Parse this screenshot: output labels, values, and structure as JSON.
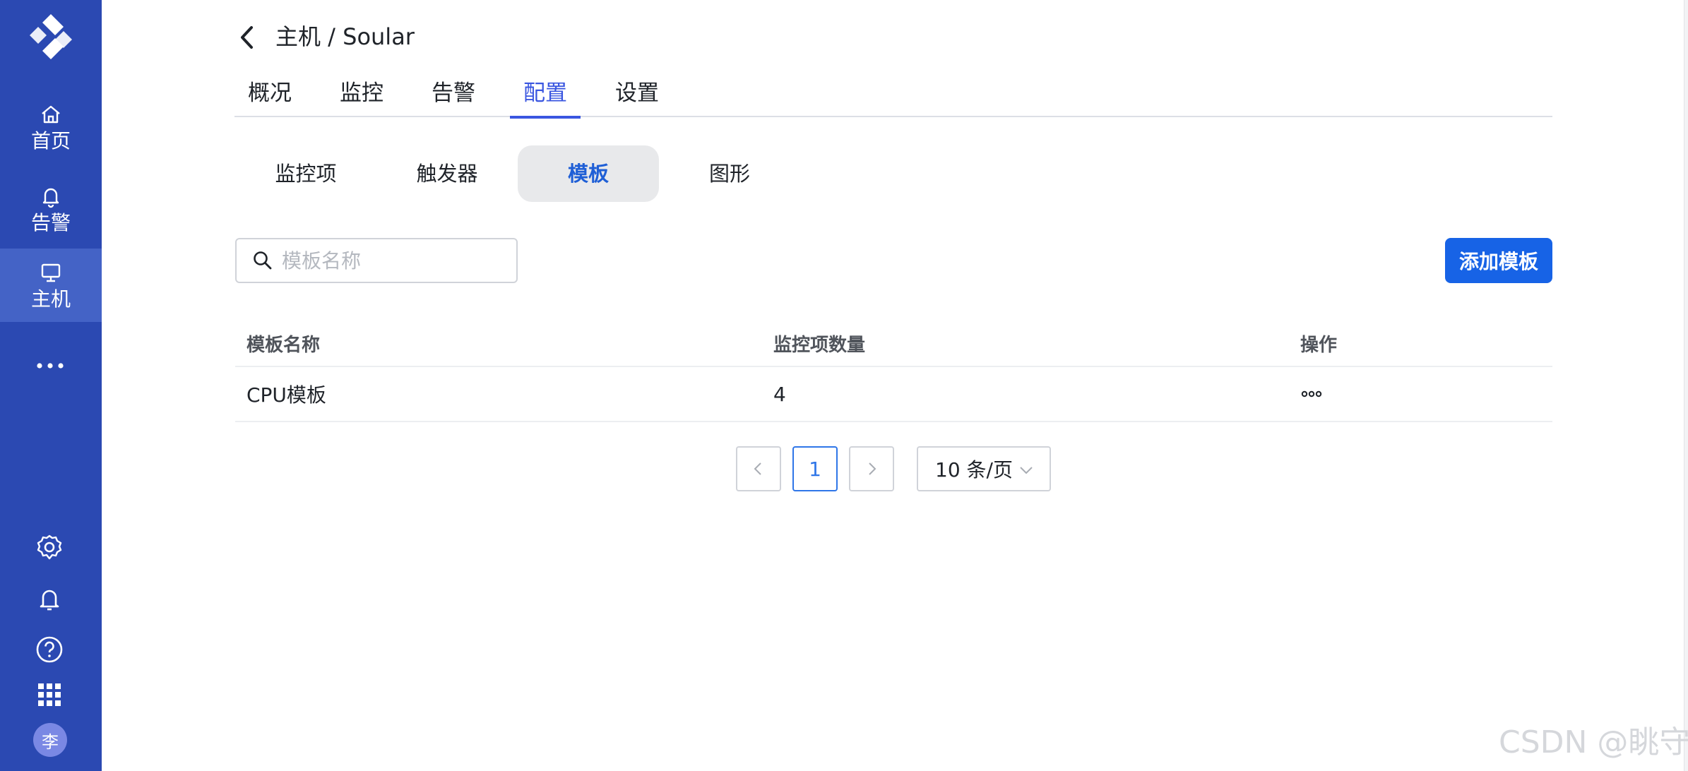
{
  "sidebar": {
    "nav": [
      {
        "label": "首页",
        "icon": "home-icon"
      },
      {
        "label": "告警",
        "icon": "bell-icon"
      },
      {
        "label": "主机",
        "icon": "monitor-icon"
      }
    ],
    "active": "主机",
    "more_icon": "more-dots-icon",
    "bottom_icons": [
      "settings-icon",
      "notification-bell-icon",
      "help-icon",
      "apps-grid-icon"
    ],
    "avatar_text": "李"
  },
  "header": {
    "title": "主机 / Soular"
  },
  "tabs": [
    {
      "label": "概况"
    },
    {
      "label": "监控"
    },
    {
      "label": "告警"
    },
    {
      "label": "配置"
    },
    {
      "label": "设置"
    }
  ],
  "active_tab": "配置",
  "subtabs": [
    {
      "label": "监控项"
    },
    {
      "label": "触发器"
    },
    {
      "label": "模板"
    },
    {
      "label": "图形"
    }
  ],
  "active_subtab": "模板",
  "search": {
    "placeholder": "模板名称",
    "value": ""
  },
  "toolbar": {
    "add_label": "添加模板"
  },
  "table": {
    "columns": [
      "模板名称",
      "监控项数量",
      "操作"
    ],
    "rows": [
      {
        "name": "CPU模板",
        "count": "4",
        "action_icon": "more-actions-icon"
      }
    ]
  },
  "pagination": {
    "current_page": "1",
    "page_size": "10 条/页"
  },
  "watermark": "CSDN @眺守",
  "colors": {
    "sidebar_bg": "#2b49b2",
    "sidebar_active": "#4463c6",
    "accent": "#3a56e0",
    "primary_button": "#1763e6",
    "subtab_active_text": "#1f5fd6"
  }
}
